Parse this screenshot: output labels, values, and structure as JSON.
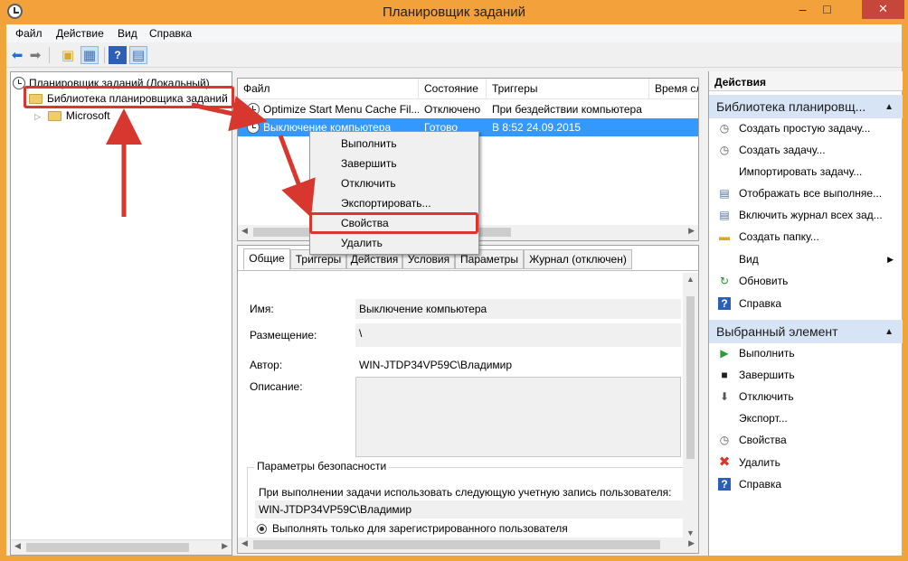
{
  "window": {
    "title": "Планировщик заданий",
    "minimize": "–",
    "maximize": "□",
    "close": "✕"
  },
  "menubar": [
    "Файл",
    "Действие",
    "Вид",
    "Справка"
  ],
  "tree": {
    "root": "Планировщик заданий (Локальный)",
    "library": "Библиотека планировщика заданий",
    "microsoft": "Microsoft"
  },
  "tasklist": {
    "columns": [
      "Файл",
      "Состояние",
      "Триггеры",
      "Время сл"
    ],
    "rows": [
      {
        "name": "Optimize Start Menu Cache Fil...",
        "status": "Отключено",
        "trigger": "При бездействии компьютера"
      },
      {
        "name": "Выключение компьютера",
        "status": "Готово",
        "trigger": "В 8:52 24.09.2015"
      }
    ]
  },
  "context_menu": [
    "Выполнить",
    "Завершить",
    "Отключить",
    "Экспортировать...",
    "Свойства",
    "Удалить"
  ],
  "details": {
    "tabs": [
      "Общие",
      "Триггеры",
      "Действия",
      "Условия",
      "Параметры",
      "Журнал (отключен)"
    ],
    "name_label": "Имя:",
    "name_value": "Выключение компьютера",
    "location_label": "Размещение:",
    "location_value": "\\",
    "author_label": "Автор:",
    "author_value": "WIN-JTDP34VP59C\\Владимир",
    "description_label": "Описание:",
    "security_title": "Параметры безопасности",
    "security_text": "При выполнении задачи использовать следующую учетную запись пользователя:",
    "security_account": "WIN-JTDP34VP59C\\Владимир",
    "security_option": "Выполнять только для зарегистрированного пользователя"
  },
  "actions": {
    "title": "Действия",
    "section1": "Библиотека планировщ...",
    "items1": [
      "Создать простую задачу...",
      "Создать задачу...",
      "Импортировать задачу...",
      "Отображать все выполняе...",
      "Включить журнал всех зад...",
      "Создать папку...",
      "Вид",
      "Обновить",
      "Справка"
    ],
    "section2": "Выбранный элемент",
    "items2": [
      "Выполнить",
      "Завершить",
      "Отключить",
      "Экспорт...",
      "Свойства",
      "Удалить",
      "Справка"
    ]
  },
  "colors": {
    "accent": "#f3a13b",
    "selection": "#3399ff",
    "annotation": "#d8372f",
    "section_bg": "#d6e4f5"
  }
}
